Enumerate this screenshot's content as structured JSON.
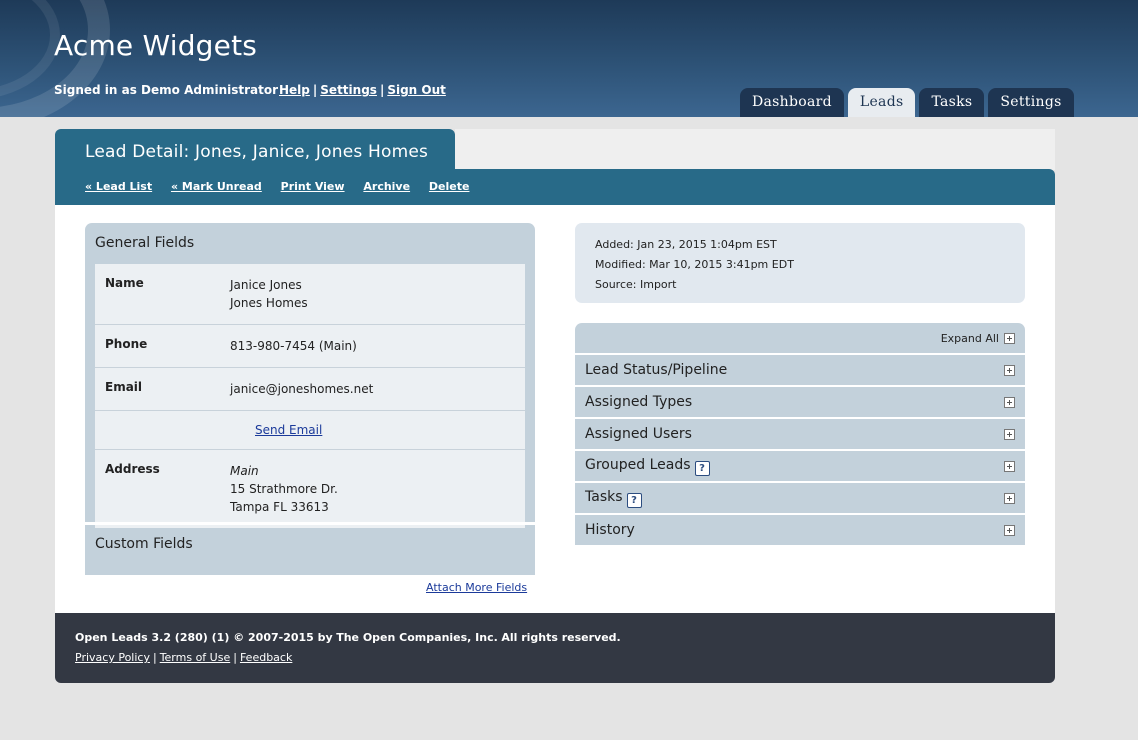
{
  "header": {
    "app_title": "Acme Widgets",
    "signed_in": "Signed in as Demo Administrator",
    "links": {
      "help": "Help",
      "settings": "Settings",
      "sign_out": "Sign Out",
      "separator": "|"
    }
  },
  "nav_tabs": [
    {
      "label": "Dashboard",
      "active": false
    },
    {
      "label": "Leads",
      "active": true
    },
    {
      "label": "Tasks",
      "active": false
    },
    {
      "label": "Settings",
      "active": false
    }
  ],
  "panel": {
    "title": "Lead Detail: Jones, Janice, Jones Homes",
    "actions": {
      "lead_list": "« Lead List",
      "mark_unread": "« Mark Unread",
      "print_view": "Print View",
      "archive": "Archive",
      "delete": "Delete"
    }
  },
  "general_fields": {
    "heading": "General Fields",
    "name": {
      "label": "Name",
      "line1": "Janice Jones",
      "line2": "Jones Homes"
    },
    "phone": {
      "label": "Phone",
      "value": "813-980-7454 (Main)"
    },
    "email": {
      "label": "Email",
      "value": "janice@joneshomes.net",
      "send_link": "Send Email"
    },
    "address": {
      "label": "Address",
      "type": "Main",
      "line1": "15 Strathmore Dr.",
      "line2": "Tampa FL 33613"
    }
  },
  "custom_fields": {
    "heading": "Custom Fields",
    "attach_link": "Attach More Fields"
  },
  "meta": {
    "added": "Added: Jan 23, 2015 1:04pm EST",
    "modified": "Modified: Mar 10, 2015 3:41pm EDT",
    "source": "Source: Import"
  },
  "accordion": {
    "expand_all": "Expand All",
    "help_mark": "?",
    "items": [
      {
        "label": "Lead Status/Pipeline"
      },
      {
        "label": "Assigned Types"
      },
      {
        "label": "Assigned Users"
      },
      {
        "label": "Grouped Leads"
      },
      {
        "label": "Tasks"
      },
      {
        "label": "History"
      }
    ]
  },
  "footer": {
    "version": "Open Leads 3.2 (280) (1) © 2007-2015 by",
    "company": "The Open Companies, Inc.",
    "rights": "All rights reserved.",
    "links": {
      "privacy": "Privacy Policy",
      "terms": "Terms of Use",
      "feedback": "Feedback",
      "separator": "|"
    }
  }
}
